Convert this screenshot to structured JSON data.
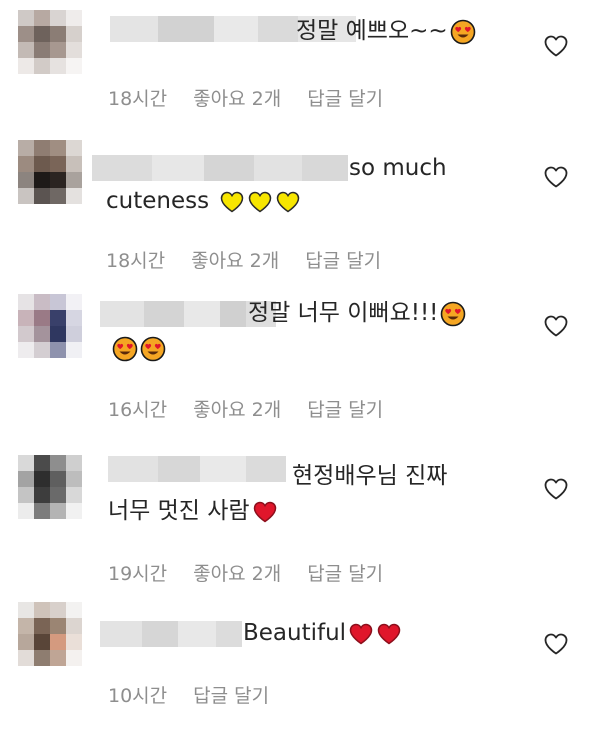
{
  "comments": [
    {
      "text_line1": "정말 예쁘오~~",
      "text_line2": "",
      "emoji_line1": [
        "heart-eyes-emoji"
      ],
      "emoji_line2": [],
      "time": "18시간",
      "likes": "좋아요 2개",
      "reply": "답글 달기"
    },
    {
      "text_line1": "so much",
      "text_line2": "cuteness",
      "emoji_line1": [],
      "emoji_line2": [
        "yellow-heart-emoji",
        "yellow-heart-emoji",
        "yellow-heart-emoji"
      ],
      "time": "18시간",
      "likes": "좋아요 2개",
      "reply": "답글 달기"
    },
    {
      "text_line1": "정말 너무 이뻐요!!!",
      "text_line2": "",
      "emoji_line1": [
        "heart-eyes-emoji"
      ],
      "emoji_line2": [
        "heart-eyes-emoji",
        "heart-eyes-emoji"
      ],
      "time": "16시간",
      "likes": "좋아요 2개",
      "reply": "답글 달기"
    },
    {
      "text_line1": "현정배우님 진짜",
      "text_line2": "너무 멋진 사람",
      "emoji_line1": [],
      "emoji_line2": [
        "red-heart-emoji"
      ],
      "time": "19시간",
      "likes": "좋아요 2개",
      "reply": "답글 달기"
    },
    {
      "text_line1": "Beautiful",
      "text_line2": "",
      "emoji_line1": [
        "red-heart-emoji",
        "red-heart-emoji"
      ],
      "emoji_line2": [],
      "time": "10시간",
      "likes": "",
      "reply": "답글 달기"
    }
  ],
  "colors": {
    "text": "#262626",
    "meta": "#8e8e8e",
    "heart_outline": "#262626",
    "yellow_heart": "#f7e600",
    "red_heart": "#e0162b",
    "emoji_face": "#f5a623",
    "emoji_heart_eyes": "#e0162b"
  },
  "icons": {
    "like_button": "heart-outline-icon"
  }
}
